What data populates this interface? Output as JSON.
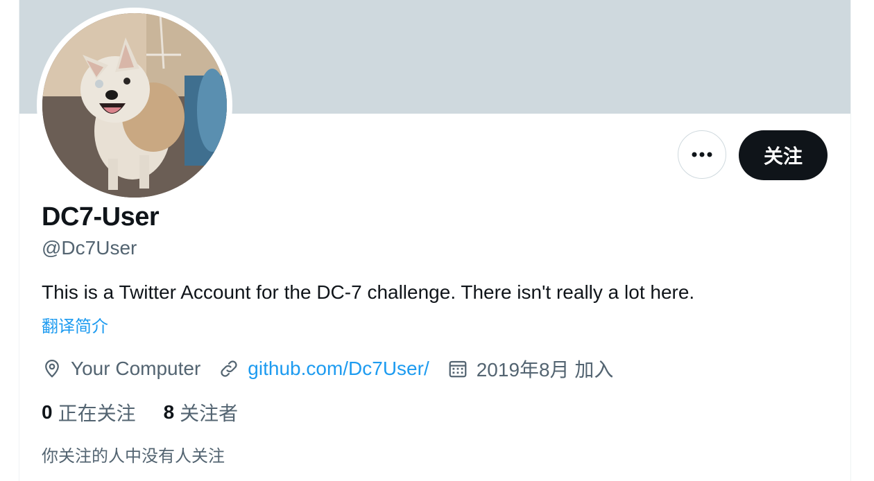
{
  "profile": {
    "display_name": "DC7-User",
    "handle": "@Dc7User",
    "bio": "This is a Twitter Account for the DC-7 challenge. There isn't really a lot here.",
    "translate_label": "翻译简介",
    "location": "Your Computer",
    "website": "github.com/Dc7User/",
    "joined": "2019年8月 加入"
  },
  "actions": {
    "follow_label": "关注",
    "more_icon": "more-horizontal-icon"
  },
  "stats": {
    "following_count": "0",
    "following_label": "正在关注",
    "followers_count": "8",
    "followers_label": "关注者"
  },
  "followers_note": "你关注的人中没有人关注",
  "colors": {
    "banner": "#cfd9de",
    "accent": "#1d9bf0",
    "primary_text": "#0f1419",
    "secondary_text": "#536471",
    "follow_button": "#0f1419"
  },
  "icons": {
    "location": "location-pin-icon",
    "website": "link-icon",
    "joined": "calendar-icon"
  }
}
